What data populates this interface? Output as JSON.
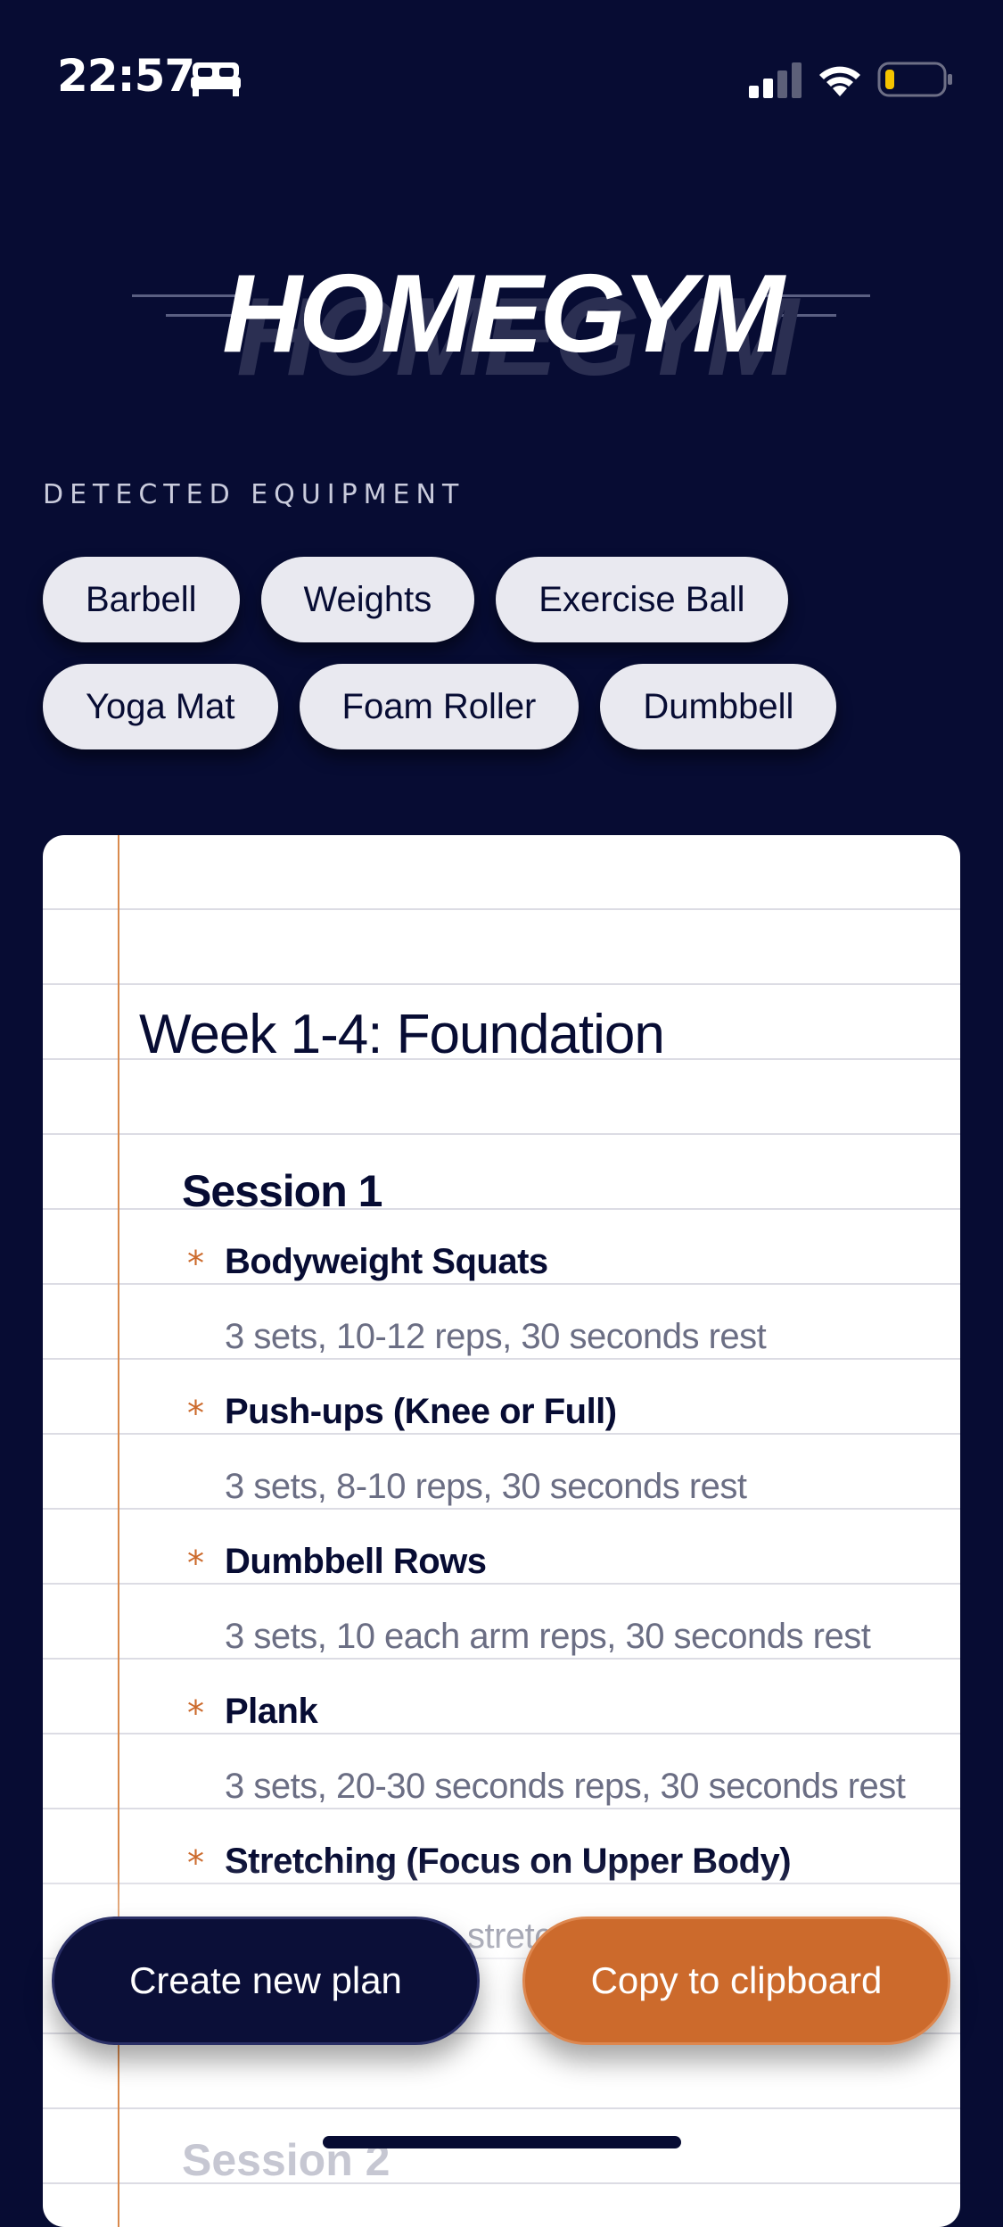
{
  "status_bar": {
    "time": "22:57",
    "icons": [
      "bed-icon",
      "cellular-signal-icon",
      "wifi-icon",
      "battery-low-icon"
    ]
  },
  "logo": {
    "text": "HOMEGYM"
  },
  "equipment": {
    "label": "DETECTED EQUIPMENT",
    "rows": [
      [
        "Barbell",
        "Weights",
        "Exercise Ball"
      ],
      [
        "Yoga Mat",
        "Foam Roller",
        "Dumbbell"
      ]
    ]
  },
  "plan": {
    "week_title": "Week 1-4: Foundation",
    "session_title": "Session 1",
    "exercises": [
      {
        "name": "Bodyweight Squats",
        "detail": "3 sets, 10-12 reps, 30 seconds rest"
      },
      {
        "name": "Push-ups (Knee or Full)",
        "detail": "3 sets, 8-10 reps, 30 seconds rest"
      },
      {
        "name": "Dumbbell Rows",
        "detail": "3 sets, 10 each arm reps, 30 seconds rest"
      },
      {
        "name": "Plank",
        "detail": "3 sets, 20-30 seconds reps, 30 seconds rest"
      },
      {
        "name": "Stretching (Focus on Upper Body)",
        "detail": "stretc"
      }
    ],
    "next_session_title": "Session 2"
  },
  "actions": {
    "create_label": "Create new plan",
    "copy_label": "Copy to clipboard"
  },
  "colors": {
    "background": "#070c33",
    "accent": "#cc6a2c",
    "chip": "#e9e9f0",
    "card": "#ffffff"
  }
}
